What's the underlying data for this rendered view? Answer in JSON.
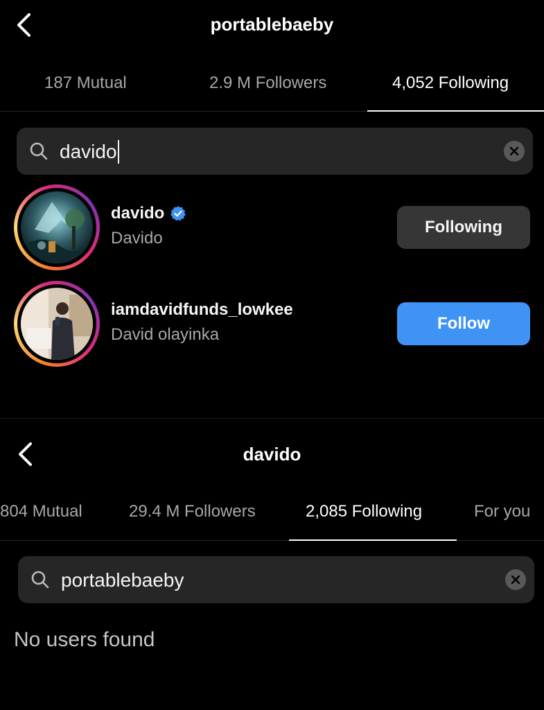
{
  "panel1": {
    "title": "portablebaeby",
    "tabs": [
      {
        "label": "187 Mutual",
        "active": false
      },
      {
        "label": "2.9 M Followers",
        "active": false
      },
      {
        "label": "4,052 Following",
        "active": true
      }
    ],
    "search": {
      "value": "davido"
    },
    "users": [
      {
        "username": "davido",
        "verified": true,
        "fullname": "Davido",
        "button": "Following",
        "button_style": "secondary"
      },
      {
        "username": "iamdavidfunds_lowkee",
        "verified": false,
        "fullname": "David olayinka",
        "button": "Follow",
        "button_style": "primary"
      }
    ]
  },
  "panel2": {
    "title": "davido",
    "tabs": [
      {
        "label": "804 Mutual",
        "active": false
      },
      {
        "label": "29.4 M Followers",
        "active": false
      },
      {
        "label": "2,085 Following",
        "active": true
      },
      {
        "label": "For you",
        "active": false
      }
    ],
    "search": {
      "value": "portablebaeby"
    },
    "empty_message": "No users found"
  },
  "colors": {
    "background": "#000000",
    "search_bg": "#262626",
    "follow_button": "#3f93f5",
    "following_button": "#363636",
    "muted_text": "#a8a8a8",
    "verified_badge": "#3f93f5"
  },
  "icons": {
    "back": "chevron-left-icon",
    "search": "search-icon",
    "clear": "clear-icon",
    "verified": "verified-badge-icon"
  }
}
